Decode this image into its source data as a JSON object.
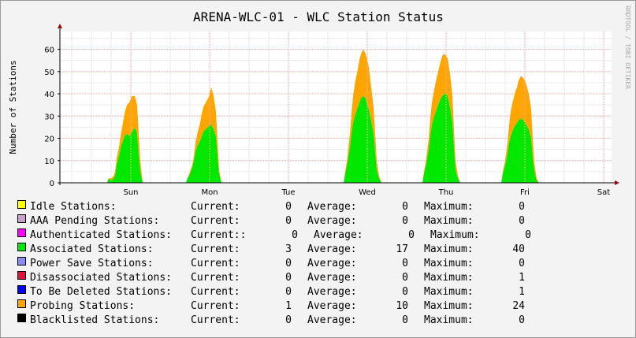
{
  "chart_data": {
    "type": "area",
    "title": "ARENA-WLC-01 - WLC Station Status",
    "ylabel": "Number of Stations",
    "xlabel": "",
    "watermark": "RRDTOOL / TOBI OETIKER",
    "ylim": [
      0,
      68
    ],
    "yticks": [
      0,
      10,
      20,
      30,
      40,
      50,
      60
    ],
    "xlim": [
      0,
      6.1
    ],
    "xticks": [
      {
        "label": "Sun",
        "x": 0.9
      },
      {
        "label": "Mon",
        "x": 1.9
      },
      {
        "label": "Tue",
        "x": 2.9
      },
      {
        "label": "Wed",
        "x": 3.9
      },
      {
        "label": "Thu",
        "x": 4.9
      },
      {
        "label": "Fri",
        "x": 5.9
      },
      {
        "label": "Sat",
        "x": 6.9
      }
    ],
    "grid": true,
    "stacked": true,
    "x": [
      0.6,
      0.62,
      0.65,
      0.68,
      0.7,
      0.72,
      0.75,
      0.78,
      0.8,
      0.82,
      0.85,
      0.88,
      0.9,
      0.92,
      0.95,
      0.98,
      1.0,
      1.02,
      1.05,
      1.08,
      1.6,
      1.62,
      1.65,
      1.68,
      1.7,
      1.72,
      1.75,
      1.78,
      1.8,
      1.82,
      1.85,
      1.88,
      1.9,
      1.92,
      1.95,
      1.98,
      2.0,
      2.02,
      2.05,
      2.08,
      3.6,
      3.62,
      3.65,
      3.68,
      3.7,
      3.72,
      3.75,
      3.78,
      3.8,
      3.82,
      3.85,
      3.88,
      3.9,
      3.92,
      3.95,
      3.98,
      4.0,
      4.02,
      4.05,
      4.08,
      4.6,
      4.62,
      4.65,
      4.68,
      4.7,
      4.72,
      4.75,
      4.78,
      4.8,
      4.82,
      4.85,
      4.88,
      4.9,
      4.92,
      4.95,
      4.98,
      5.0,
      5.02,
      5.05,
      5.08,
      5.6,
      5.62,
      5.65,
      5.68,
      5.7,
      5.72,
      5.75,
      5.78,
      5.8,
      5.82,
      5.85,
      5.88,
      5.9,
      5.92,
      5.95,
      5.98,
      6.0,
      6.02,
      6.05,
      6.08
    ],
    "series": [
      {
        "name": "Associated Stations",
        "color": "#00e800",
        "values": [
          0,
          2,
          1,
          2,
          3,
          8,
          12,
          17,
          19,
          21,
          22,
          21,
          22,
          23,
          25,
          22,
          12,
          5,
          0,
          0,
          0,
          2,
          4,
          7,
          10,
          14,
          17,
          19,
          21,
          23,
          24,
          25,
          26,
          26,
          24,
          21,
          12,
          4,
          0,
          0,
          0,
          4,
          9,
          16,
          22,
          27,
          31,
          34,
          36,
          38,
          39,
          38,
          35,
          33,
          28,
          22,
          14,
          6,
          2,
          0,
          0,
          4,
          9,
          15,
          21,
          26,
          30,
          33,
          35,
          37,
          39,
          40,
          40,
          39,
          34,
          27,
          16,
          6,
          2,
          0,
          0,
          4,
          8,
          13,
          18,
          21,
          24,
          26,
          27,
          28,
          29,
          28,
          27,
          26,
          24,
          20,
          11,
          5,
          1,
          0
        ]
      },
      {
        "name": "Probing Stations",
        "color": "#ffa500",
        "values": [
          0,
          0,
          1,
          1,
          2,
          3,
          4,
          6,
          8,
          10,
          13,
          15,
          16,
          16,
          14,
          13,
          10,
          5,
          0,
          0,
          0,
          0,
          1,
          1,
          2,
          4,
          6,
          8,
          10,
          11,
          12,
          13,
          14,
          17,
          15,
          11,
          7,
          2,
          0,
          0,
          0,
          1,
          3,
          6,
          9,
          12,
          15,
          17,
          19,
          20,
          21,
          20,
          20,
          19,
          15,
          12,
          8,
          4,
          1,
          0,
          0,
          1,
          2,
          5,
          8,
          10,
          12,
          14,
          15,
          16,
          18,
          18,
          17,
          17,
          15,
          12,
          8,
          4,
          1,
          0,
          0,
          1,
          2,
          5,
          8,
          11,
          13,
          15,
          16,
          18,
          19,
          19,
          19,
          18,
          16,
          13,
          9,
          4,
          1,
          0
        ]
      }
    ],
    "legend": [
      {
        "name": "Idle Stations:",
        "color": "#ffff00",
        "current_label": "Current:",
        "current": "0",
        "average": "0",
        "maximum": "0"
      },
      {
        "name": "AAA Pending Stations:",
        "color": "#c8a2c8",
        "current_label": "Current:",
        "current": "0",
        "average": "0",
        "maximum": "0"
      },
      {
        "name": "Authenticated Stations:",
        "color": "#ff00ff",
        "current_label": "Current::",
        "current": "0",
        "average": "0",
        "maximum": "0"
      },
      {
        "name": "Associated Stations:",
        "color": "#00e800",
        "current_label": "Current:",
        "current": "3",
        "average": "17",
        "maximum": "40"
      },
      {
        "name": "Power Save Stations:",
        "color": "#8c8cf0",
        "current_label": "Current:",
        "current": "0",
        "average": "0",
        "maximum": "0"
      },
      {
        "name": "Disassociated Stations:",
        "color": "#dc143c",
        "current_label": "Current:",
        "current": "0",
        "average": "0",
        "maximum": "1"
      },
      {
        "name": "To Be Deleted Stations:",
        "color": "#0000ff",
        "current_label": "Current:",
        "current": "0",
        "average": "0",
        "maximum": "1"
      },
      {
        "name": "Probing Stations:",
        "color": "#ffa500",
        "current_label": "Current:",
        "current": "1",
        "average": "10",
        "maximum": "24"
      },
      {
        "name": "Blacklisted Stations:",
        "color": "#000000",
        "current_label": "Current:",
        "current": "0",
        "average": "0",
        "maximum": "0"
      }
    ],
    "legend_labels": {
      "average": "Average:",
      "maximum": "Maximum:"
    }
  }
}
